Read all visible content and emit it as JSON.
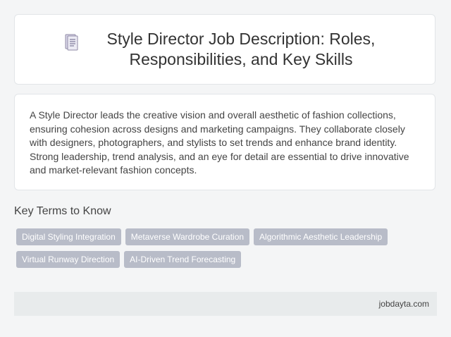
{
  "header": {
    "icon": "document-icon",
    "title": "Style Director Job Description: Roles, Responsibilities, and Key Skills"
  },
  "description": {
    "text": "A Style Director leads the creative vision and overall aesthetic of fashion collections, ensuring cohesion across designs and marketing campaigns. They collaborate closely with designers, photographers, and stylists to set trends and enhance brand identity. Strong leadership, trend analysis, and an eye for detail are essential to drive innovative and market-relevant fashion concepts."
  },
  "key_terms": {
    "heading": "Key Terms to Know",
    "items": [
      "Digital Styling Integration",
      "Metaverse Wardrobe Curation",
      "Algorithmic Aesthetic Leadership",
      "Virtual Runway Direction",
      "AI-Driven Trend Forecasting"
    ]
  },
  "footer": {
    "site": "jobdayta.com"
  },
  "colors": {
    "tag_background": "#b8bcc8",
    "footer_background": "#e8ebec",
    "page_background": "#f4f5f6"
  }
}
